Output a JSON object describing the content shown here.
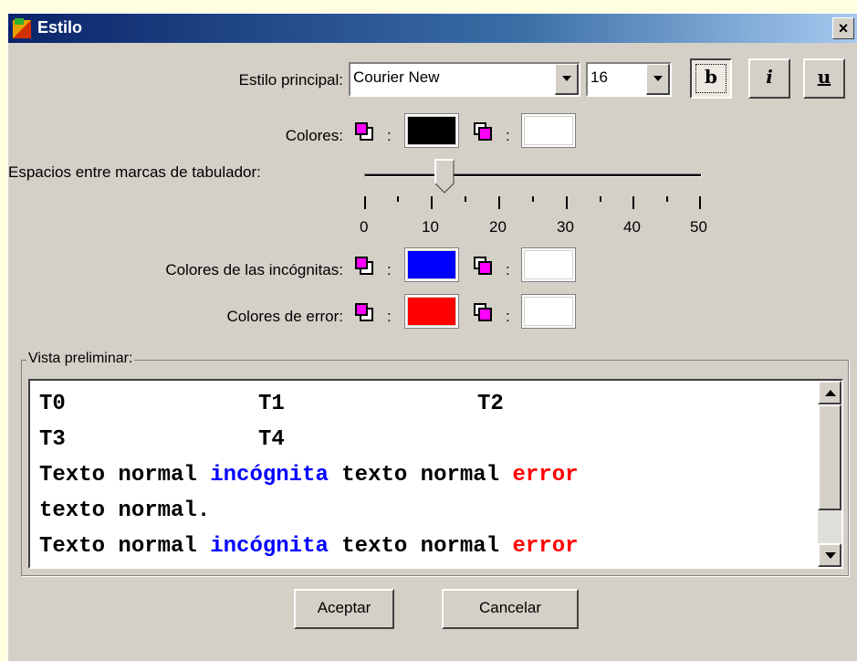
{
  "window": {
    "title": "Estilo",
    "close_symbol": "×"
  },
  "main_style": {
    "label": "Estilo principal:",
    "font_name": "Courier New",
    "font_size": "16",
    "bold_label": "b",
    "italic_label": "i",
    "underline_label": "u",
    "bold_active": true
  },
  "colors": {
    "label": "Colores:",
    "separator": ":",
    "foreground": "#000000",
    "background": "#ffffff"
  },
  "tab_spacing": {
    "label": "Espacios entre marcas de tabulador:",
    "value": 12,
    "min": 0,
    "max": 50,
    "tick_labels": [
      "0",
      "10",
      "20",
      "30",
      "40",
      "50"
    ]
  },
  "unknown_colors": {
    "label": "Colores de las incógnitas:",
    "separator": ":",
    "foreground": "#0000ff",
    "background": "#ffffff"
  },
  "error_colors": {
    "label": "Colores de error:",
    "separator": ":",
    "foreground": "#ff0000",
    "background": "#ffffff"
  },
  "preview": {
    "legend": "Vista preliminar:",
    "line1": {
      "a": "T0",
      "b": "T1",
      "c": "T2"
    },
    "line2": {
      "a": "T3",
      "b": "T4"
    },
    "line3": {
      "normal1": "Texto normal ",
      "unknown": "incógnita",
      "normal2": " texto normal ",
      "error": "error"
    },
    "line4": "texto normal.",
    "line5": {
      "normal1": "Texto normal ",
      "unknown": "incógnita",
      "normal2": " texto normal ",
      "error": "error"
    }
  },
  "buttons": {
    "accept": "Aceptar",
    "cancel": "Cancelar"
  }
}
